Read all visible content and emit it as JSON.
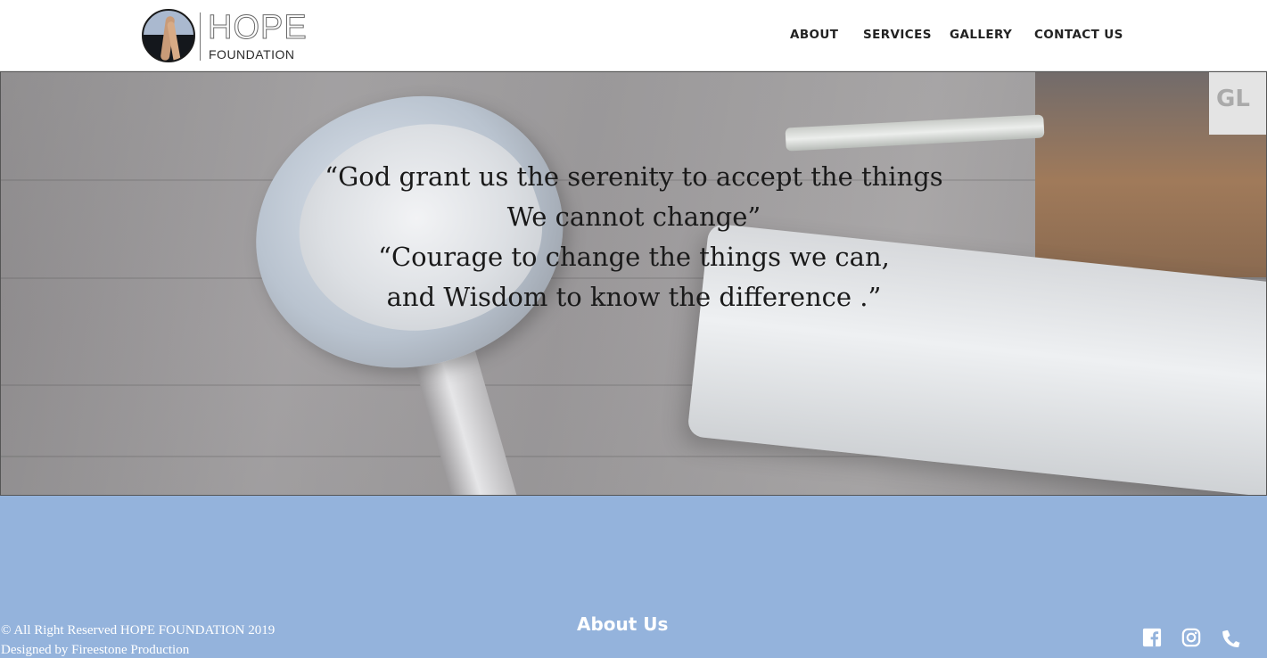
{
  "brand": {
    "name": "HOPE",
    "subtitle": "FOUNDATION"
  },
  "nav": {
    "items": [
      {
        "label": "ABOUT"
      },
      {
        "label": "SERVICES"
      },
      {
        "label": "GALLERY"
      },
      {
        "label": "CONTACT US"
      }
    ]
  },
  "hero": {
    "quote_lines": [
      "“God grant us the serenity to accept the things",
      "We cannot change”",
      "“Courage to change the things we can,",
      "and Wisdom to know the difference .”"
    ]
  },
  "footer": {
    "copyright": "© All Right Reserved HOPE FOUNDATION 2019",
    "designed_by": "Designed by Fireestone Production",
    "about_heading": "About Us",
    "social_icons": [
      "facebook-icon",
      "instagram-icon",
      "phone-icon"
    ]
  },
  "colors": {
    "footer_bg": "#94b3dc",
    "header_bg": "#ffffff",
    "nav_text": "#222222",
    "quote_text": "#1a1a1a"
  }
}
